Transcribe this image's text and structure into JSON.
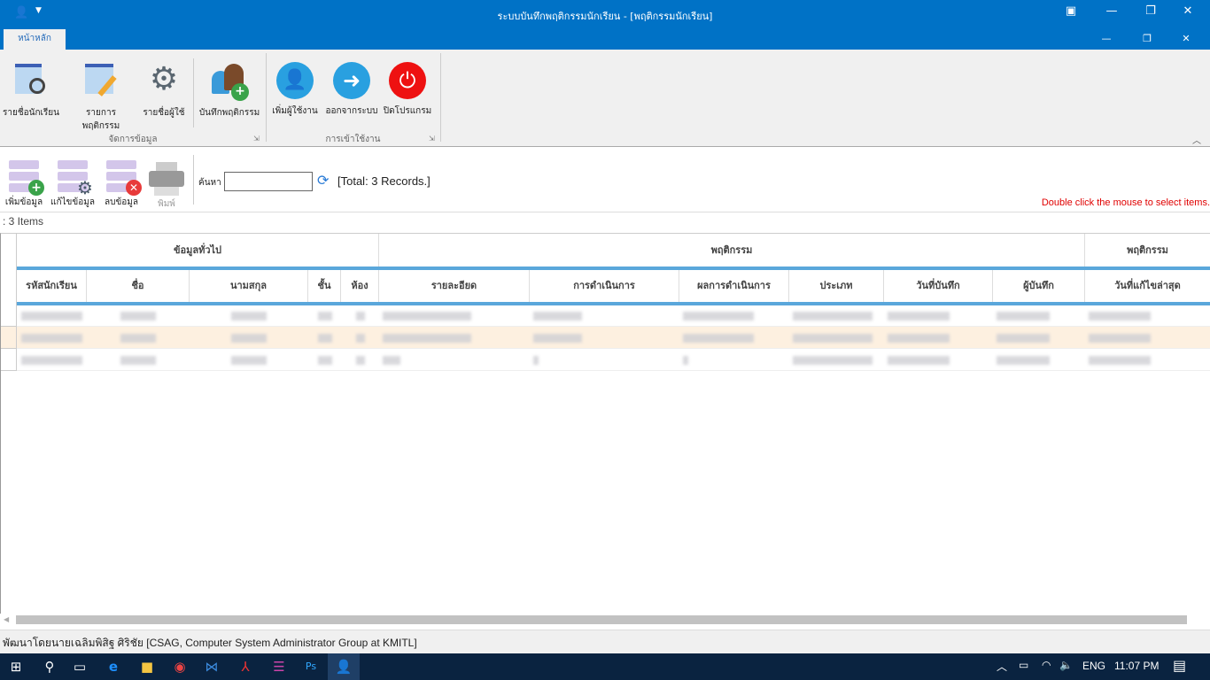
{
  "window": {
    "title": "ระบบบันทึกพฤติกรรมนักเรียน - [พฤติกรรมนักเรียน]"
  },
  "ribbon": {
    "tab": "หน้าหลัก",
    "buttons": [
      {
        "label": "รายชื่อนักเรียน",
        "icon": "student-list-icon"
      },
      {
        "label": "รายการพฤติกรรม",
        "icon": "behavior-list-icon"
      },
      {
        "label": "รายชื่อผู้ใช้",
        "icon": "user-settings-icon"
      },
      {
        "label": "บันทึกพฤติกรรม",
        "icon": "record-behavior-icon"
      },
      {
        "label": "เพิ่มผู้ใช้งาน",
        "icon": "add-user-icon"
      },
      {
        "label": "ออกจากระบบ",
        "icon": "logout-icon"
      },
      {
        "label": "ปิดโปรแกรม",
        "icon": "power-icon"
      }
    ],
    "groups": [
      "จัดการข้อมูล",
      "การเข้าใช้งาน"
    ]
  },
  "toolbar": {
    "add": "เพิ่มข้อมูล",
    "edit": "แก้ไขข้อมูล",
    "delete": "ลบข้อมูล",
    "print": "พิมพ์",
    "search_label": "ค้นหา",
    "search_value": "",
    "total": "[Total: 3 Records.]",
    "hint": "Double click the mouse to select items."
  },
  "items_count": ": 3 Items",
  "grid": {
    "groups": [
      "ข้อมูลทั่วไป",
      "พฤติกรรม",
      "พฤติกรรม"
    ],
    "columns": [
      "รหัสนักเรียน",
      "ชื่อ",
      "นามสกุล",
      "ชั้น",
      "ห้อง",
      "รายละอียด",
      "การดำเนินการ",
      "ผลการดำเนินการ",
      "ประเภท",
      "วันที่บันทึก",
      "ผู้บันทึก",
      "วันที่แก้ไขล่าสุด"
    ]
  },
  "status": "พัฒนาโดยนายเฉลิมพิสิฐ  ศิริชัย  [CSAG, Computer System Administrator Group at KMITL]",
  "taskbar": {
    "lang": "ENG",
    "time": "11:07 PM"
  },
  "colors": {
    "titlebar": "#0072c6",
    "header_line": "#5aa7db",
    "selected_row": "#fdf0e0",
    "hint": "#e00000",
    "taskbar": "#0a2340"
  }
}
